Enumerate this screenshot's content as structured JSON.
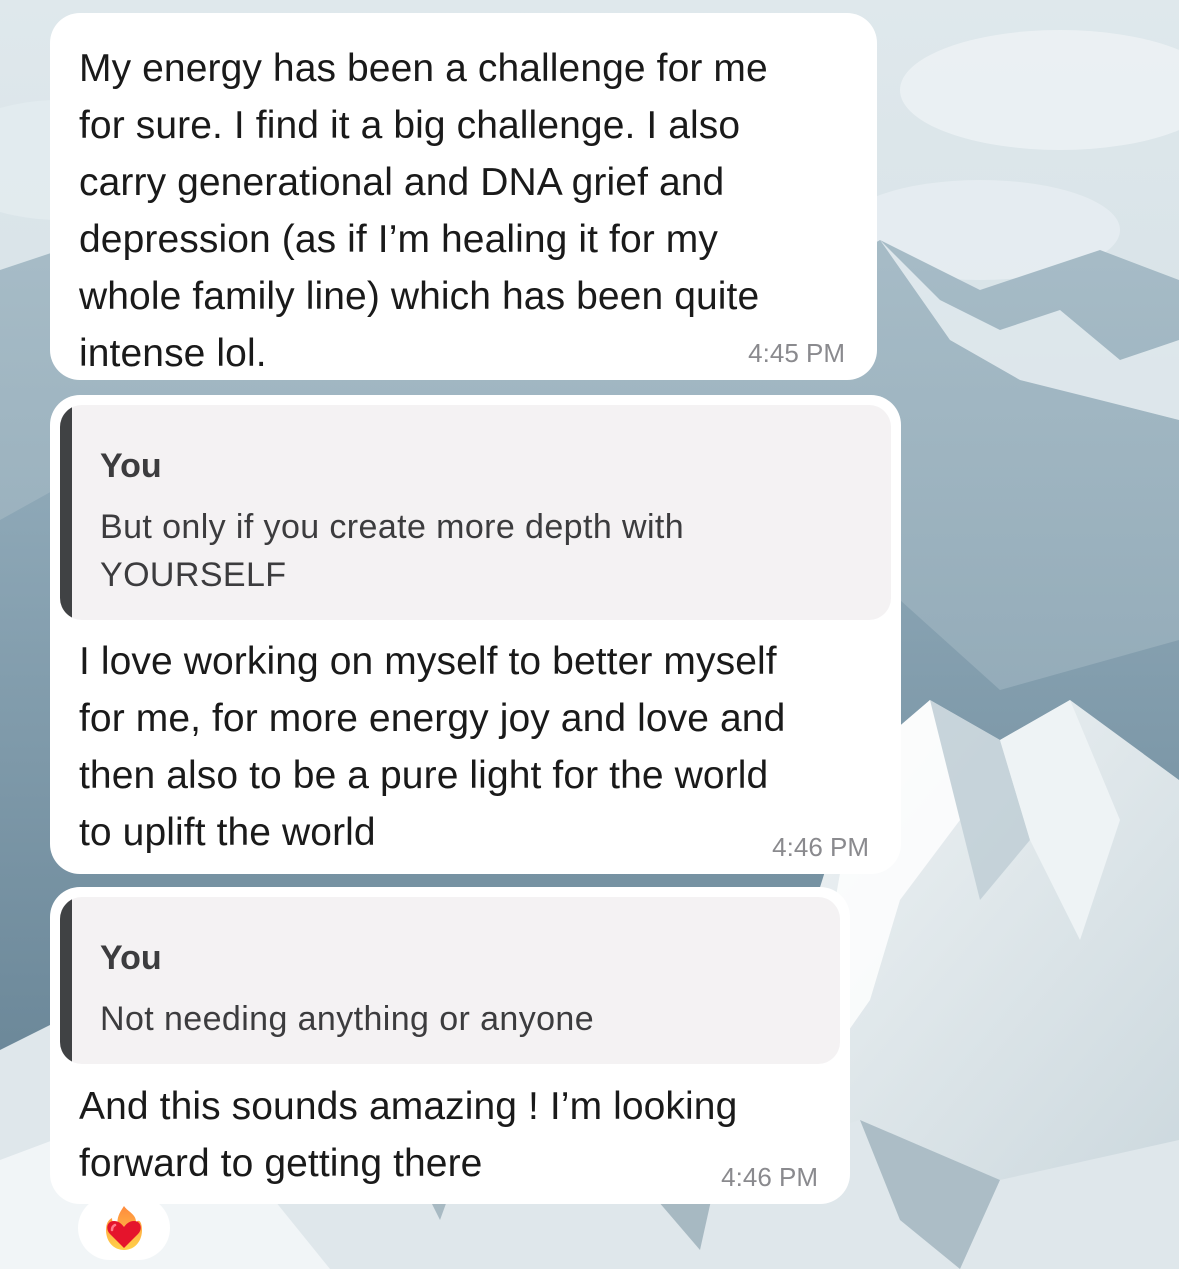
{
  "messages": [
    {
      "text": "My energy has been a challenge for me\nfor sure. I find it a big challenge. I also\ncarry generational and DNA grief and\ndepression (as if I’m healing it for my\nwhole family line) which has been quite\nintense lol.",
      "time": "4:45 PM"
    },
    {
      "reply_to": {
        "author": "You",
        "text": "But only if you create more depth with\nYOURSELF"
      },
      "text": "I love working on myself to better myself\nfor me, for more energy joy and love and\nthen also to be a pure light for the world\nto uplift the world",
      "time": "4:46 PM"
    },
    {
      "reply_to": {
        "author": "You",
        "text": "Not needing anything or anyone"
      },
      "text": "And this sounds amazing ! I’m looking\nforward to getting there",
      "time": "4:46 PM",
      "reaction": "heart-on-fire-icon"
    }
  ],
  "colors": {
    "bubble": "#ffffff",
    "quote_bg": "#f4f2f3",
    "quote_bar": "#404244",
    "timestamp": "#8a8a8e"
  }
}
